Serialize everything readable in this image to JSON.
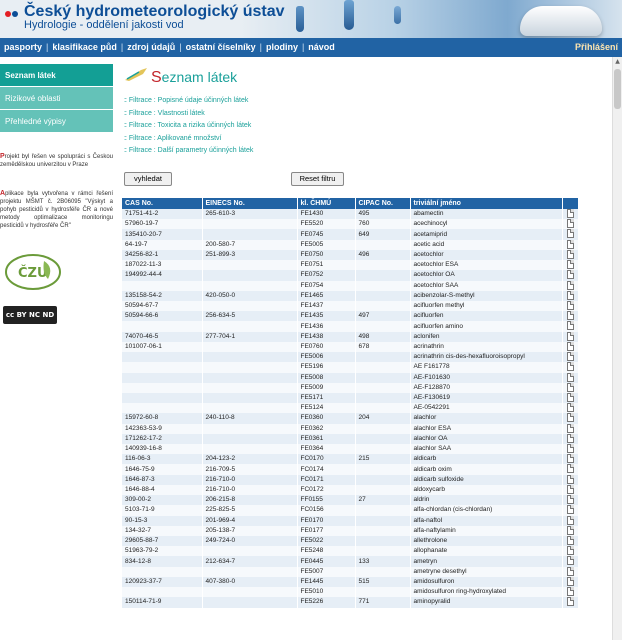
{
  "header": {
    "title": "Český hydrometeorologický ústav",
    "subtitle": "Hydrologie - oddělení jakosti vod"
  },
  "nav": {
    "items": [
      "pasporty",
      "klasifikace půd",
      "zdroj údajů",
      "ostatní číselníky",
      "plodiny",
      "návod"
    ],
    "separator": "|",
    "login": "Přihlášení"
  },
  "sidebar": {
    "items": [
      {
        "label": "Seznam látek",
        "active": true
      },
      {
        "label": "Rizikové oblasti",
        "active": false
      },
      {
        "label": "Přehledné výpisy",
        "active": false
      }
    ],
    "note1_cap": "P",
    "note1_rest": "rojekt byl řešen ve spolupráci s Českou zemědělskou univerzitou v Praze",
    "note2_cap": "A",
    "note2_rest": "plikace byla vytvořena v rámci řešení projektu MŠMT č. 2B06095 \"Výskyt a pohyb pesticidů v hydrosféře ČR a nové metody optimalizace monitoringu pesticidů v hydrosféře ČR\"",
    "czu_text": "ČESKÁ ZEMĚDĚLSKÁ UNIVERZITA V PRAZE",
    "cc_text": "cc BY NC ND"
  },
  "main": {
    "title_first": "S",
    "title_rest": "eznam látek",
    "filter_bullet": "::",
    "filters": [
      "Filtrace : Popisné údaje účinných látek",
      "Filtrace : Vlastnosti látek",
      "Filtrace : Toxicita a rizika účinných látek",
      "Filtrace : Aplikované množství",
      "Filtrace : Další parametry účinných látek"
    ],
    "search_button": "vyhledat",
    "reset_button": "Reset filtru"
  },
  "table": {
    "headers": [
      "CAS No.",
      "EINECS No.",
      "kl. ČHMÚ",
      "CIPAC No.",
      "triviální jméno",
      ""
    ],
    "rows": [
      [
        "71751-41-2",
        "265-610-3",
        "FE1430",
        "495",
        "abamectin"
      ],
      [
        "57960-19-7",
        "",
        "FE5520",
        "760",
        "acechinocyl"
      ],
      [
        "135410-20-7",
        "",
        "FE0745",
        "649",
        "acetamiprid"
      ],
      [
        "64-19-7",
        "200-580-7",
        "FE5005",
        "",
        "acetic acid"
      ],
      [
        "34256-82-1",
        "251-899-3",
        "FE0750",
        "496",
        "acetochlor"
      ],
      [
        "187022-11-3",
        "",
        "FE0751",
        "",
        "acetochlor ESA"
      ],
      [
        "194992-44-4",
        "",
        "FE0752",
        "",
        "acetochlor OA"
      ],
      [
        "",
        "",
        "FE0754",
        "",
        "acetochlor SAA"
      ],
      [
        "135158-54-2",
        "420-050-0",
        "FE1465",
        "",
        "acibenzolar-S-methyl"
      ],
      [
        "50594-67-7",
        "",
        "FE1437",
        "",
        "acifluorfen methyl"
      ],
      [
        "50594-66-6",
        "256-634-5",
        "FE1435",
        "497",
        "acifluorfen"
      ],
      [
        "",
        "",
        "FE1436",
        "",
        "acifluorfen amino"
      ],
      [
        "74070-46-5",
        "277-704-1",
        "FE1438",
        "498",
        "aclonifen"
      ],
      [
        "101007-06-1",
        "",
        "FE0760",
        "678",
        "acrinathrin"
      ],
      [
        "",
        "",
        "FE5006",
        "",
        "acrinathrin cis-des-hexafluoroisopropyl"
      ],
      [
        "",
        "",
        "FE5196",
        "",
        "AE F161778"
      ],
      [
        "",
        "",
        "FE5008",
        "",
        "AE-F101630"
      ],
      [
        "",
        "",
        "FE5009",
        "",
        "AE-F128870"
      ],
      [
        "",
        "",
        "FE5171",
        "",
        "AE-F130619"
      ],
      [
        "",
        "",
        "FE5124",
        "",
        "AE-0542291"
      ],
      [
        "15972-60-8",
        "240-110-8",
        "FE0360",
        "204",
        "alachlor"
      ],
      [
        "142363-53-9",
        "",
        "FE0362",
        "",
        "alachlor ESA"
      ],
      [
        "171262-17-2",
        "",
        "FE0361",
        "",
        "alachlor OA"
      ],
      [
        "140939-16-8",
        "",
        "FE0364",
        "",
        "alachlor SAA"
      ],
      [
        "116-06-3",
        "204-123-2",
        "FC0170",
        "215",
        "aldicarb"
      ],
      [
        "1646-75-9",
        "216-709-5",
        "FC0174",
        "",
        "aldicarb oxim"
      ],
      [
        "1646-87-3",
        "216-710-0",
        "FC0171",
        "",
        "aldicarb sulfoxide"
      ],
      [
        "1646-88-4",
        "216-710-0",
        "FC0172",
        "",
        "aldoxycarb"
      ],
      [
        "309-00-2",
        "206-215-8",
        "FF0155",
        "27",
        "aldrin"
      ],
      [
        "5103-71-9",
        "225-825-5",
        "FC0156",
        "",
        "alfa-chlordan (cis-chlordan)"
      ],
      [
        "90-15-3",
        "201-969-4",
        "FE0170",
        "",
        "alfa-naftol"
      ],
      [
        "134-32-7",
        "205-138-7",
        "FE0177",
        "",
        "alfa-naftylamin"
      ],
      [
        "29605-88-7",
        "249-724-0",
        "FE5022",
        "",
        "allethrolone"
      ],
      [
        "51963-79-2",
        "",
        "FE5248",
        "",
        "allophanate"
      ],
      [
        "834-12-8",
        "212-634-7",
        "FE0445",
        "133",
        "ametryn"
      ],
      [
        "",
        "",
        "FE5007",
        "",
        "ametryne desethyl"
      ],
      [
        "120923-37-7",
        "407-380-0",
        "FE1445",
        "515",
        "amidosulfuron"
      ],
      [
        "",
        "",
        "FE5010",
        "",
        "amidosulfuron ring-hydroxylated"
      ],
      [
        "150114-71-9",
        "",
        "FE5226",
        "771",
        "aminopyralid"
      ]
    ]
  },
  "colors": {
    "brand_blue": "#2163a4",
    "teal_active": "#139f95",
    "teal_inactive": "#64c2b8",
    "title_teal": "#1aa09a",
    "accent_red": "#c3262c"
  },
  "icons": [
    "logo-dots-icon",
    "document-icon",
    "czu-logo-icon",
    "cc-license-icon",
    "title-decoration-icon"
  ]
}
